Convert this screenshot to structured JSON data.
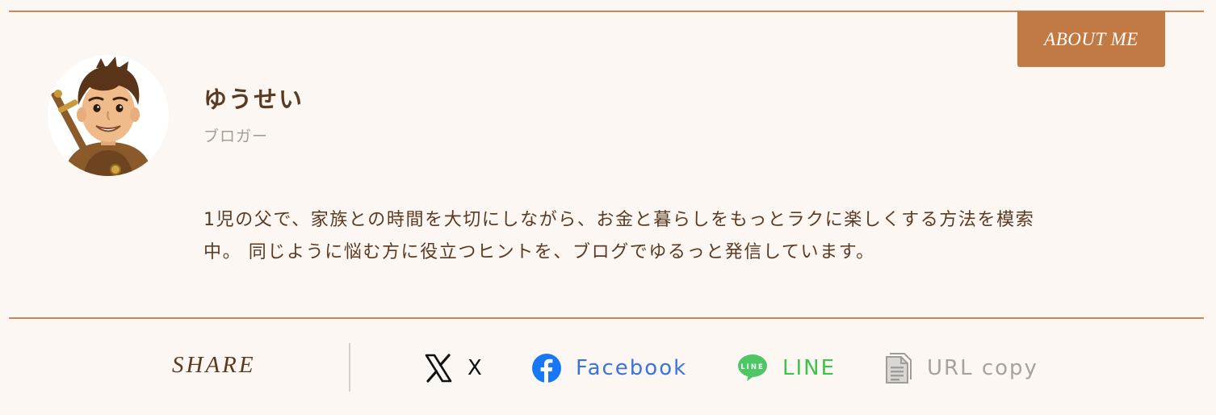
{
  "about": {
    "badge_label": "ABOUT ME"
  },
  "author": {
    "name": "ゆうせい",
    "role": "ブロガー",
    "bio_line1": "1児の父で、家族との時間を大切にしながら、お金と暮らしをもっとラクに楽しくする方法を模索",
    "bio_line2": "中。 同じように悩む方に役立つヒントを、ブログでゆるっと発信しています。"
  },
  "share": {
    "label": "SHARE",
    "buttons": [
      {
        "icon": "x-logo-icon",
        "label": "X",
        "color": "#111111"
      },
      {
        "icon": "facebook-icon",
        "label": "Facebook",
        "color": "#3a74d8"
      },
      {
        "icon": "line-icon",
        "label": "LINE",
        "color": "#3dc24a"
      },
      {
        "icon": "document-copy-icon",
        "label": "URL copy",
        "color": "#a6a29e"
      }
    ]
  },
  "colors": {
    "background": "#fcf7f2",
    "accent": "#c27a44",
    "rule": "#c9875a",
    "text": "#5b3a22"
  }
}
